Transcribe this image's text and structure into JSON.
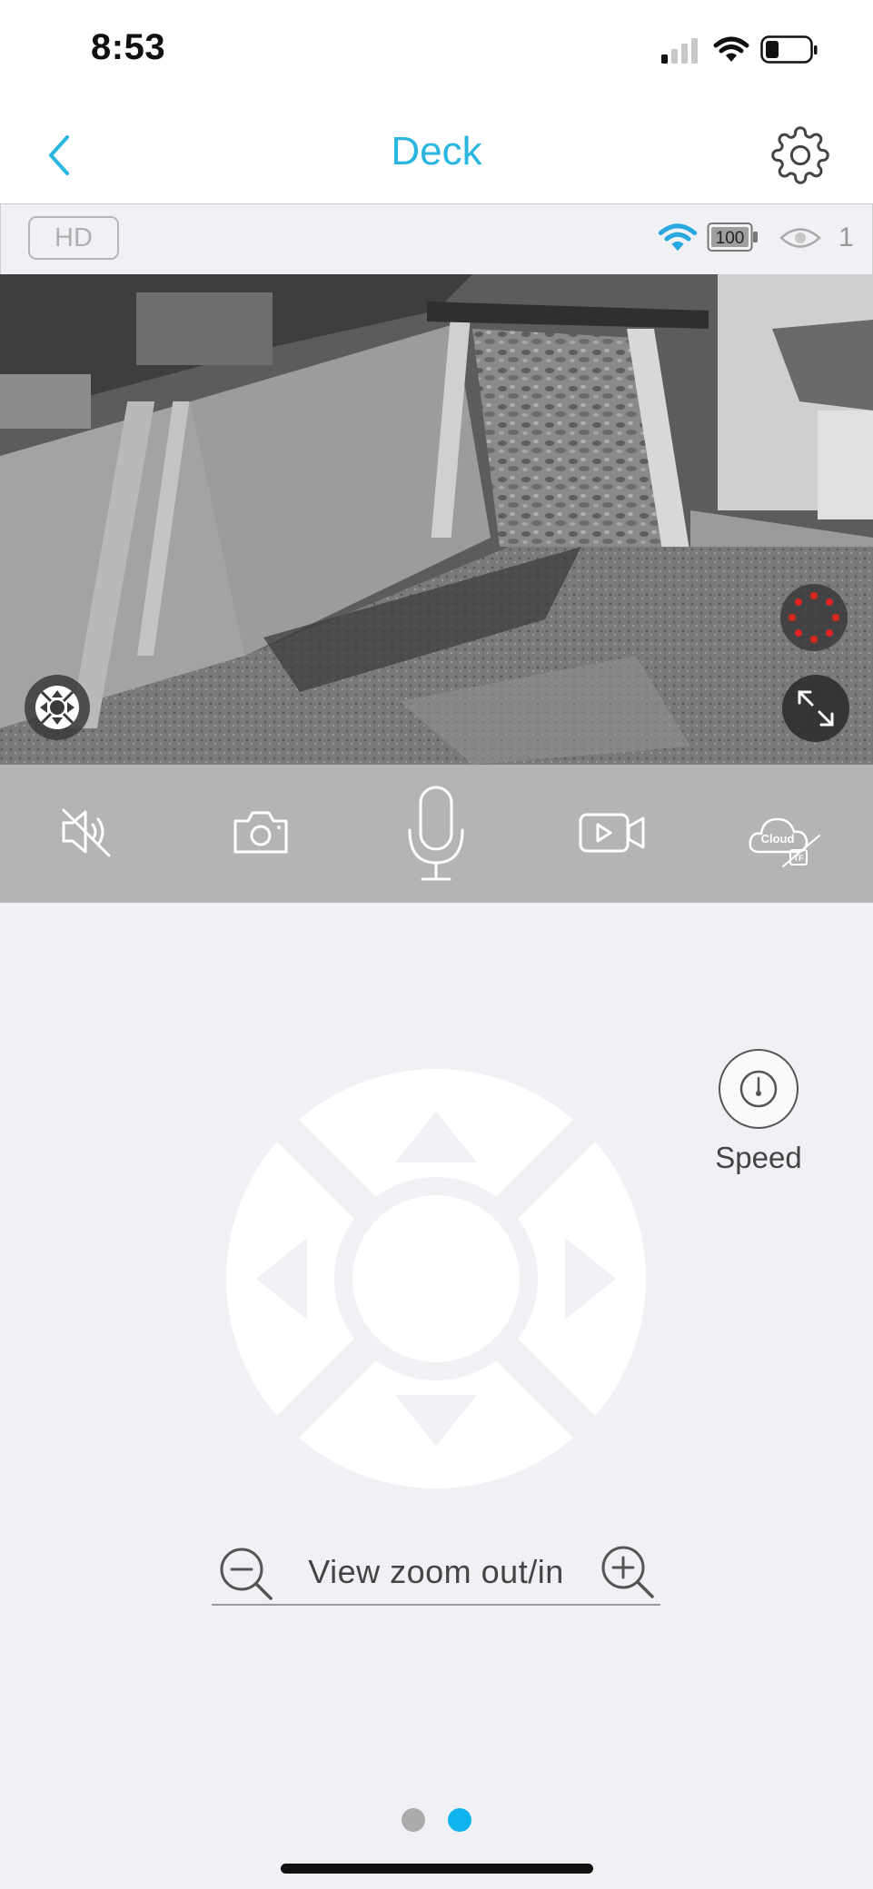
{
  "status_bar": {
    "time": "8:53",
    "icons": [
      "cellular-signal-icon",
      "wifi-icon",
      "battery-icon"
    ]
  },
  "nav": {
    "title": "Deck",
    "back_icon": "chevron-left-icon",
    "settings_icon": "gear-icon"
  },
  "info_bar": {
    "quality_label": "HD",
    "camera_battery": "100",
    "viewer_count": "1",
    "icons": [
      "wifi-icon",
      "battery-icon",
      "eye-icon"
    ]
  },
  "video": {
    "overlay_icons": [
      "ptz-control-icon",
      "recording-indicator-icon",
      "fullscreen-icon"
    ]
  },
  "controls": {
    "icons": [
      "speaker-muted-icon",
      "camera-snapshot-icon",
      "microphone-icon",
      "video-record-icon",
      "cloud-tf-icon"
    ],
    "cloud_label": "Cloud",
    "tf_label": "TF"
  },
  "ptz": {
    "speed_label": "Speed",
    "icons": [
      "arrow-up-icon",
      "arrow-down-icon",
      "arrow-left-icon",
      "arrow-right-icon",
      "speedometer-icon"
    ]
  },
  "zoom": {
    "label": "View zoom out/in",
    "icons": [
      "zoom-out-icon",
      "zoom-in-icon"
    ]
  },
  "pagination": {
    "total": 2,
    "active": 2
  },
  "colors": {
    "accent": "#29b6e0",
    "page_dot_active": "#0fb3ee",
    "page_dot_inactive": "#ababab",
    "recording_indicator": "#e02424",
    "background": "#eff1f4"
  }
}
